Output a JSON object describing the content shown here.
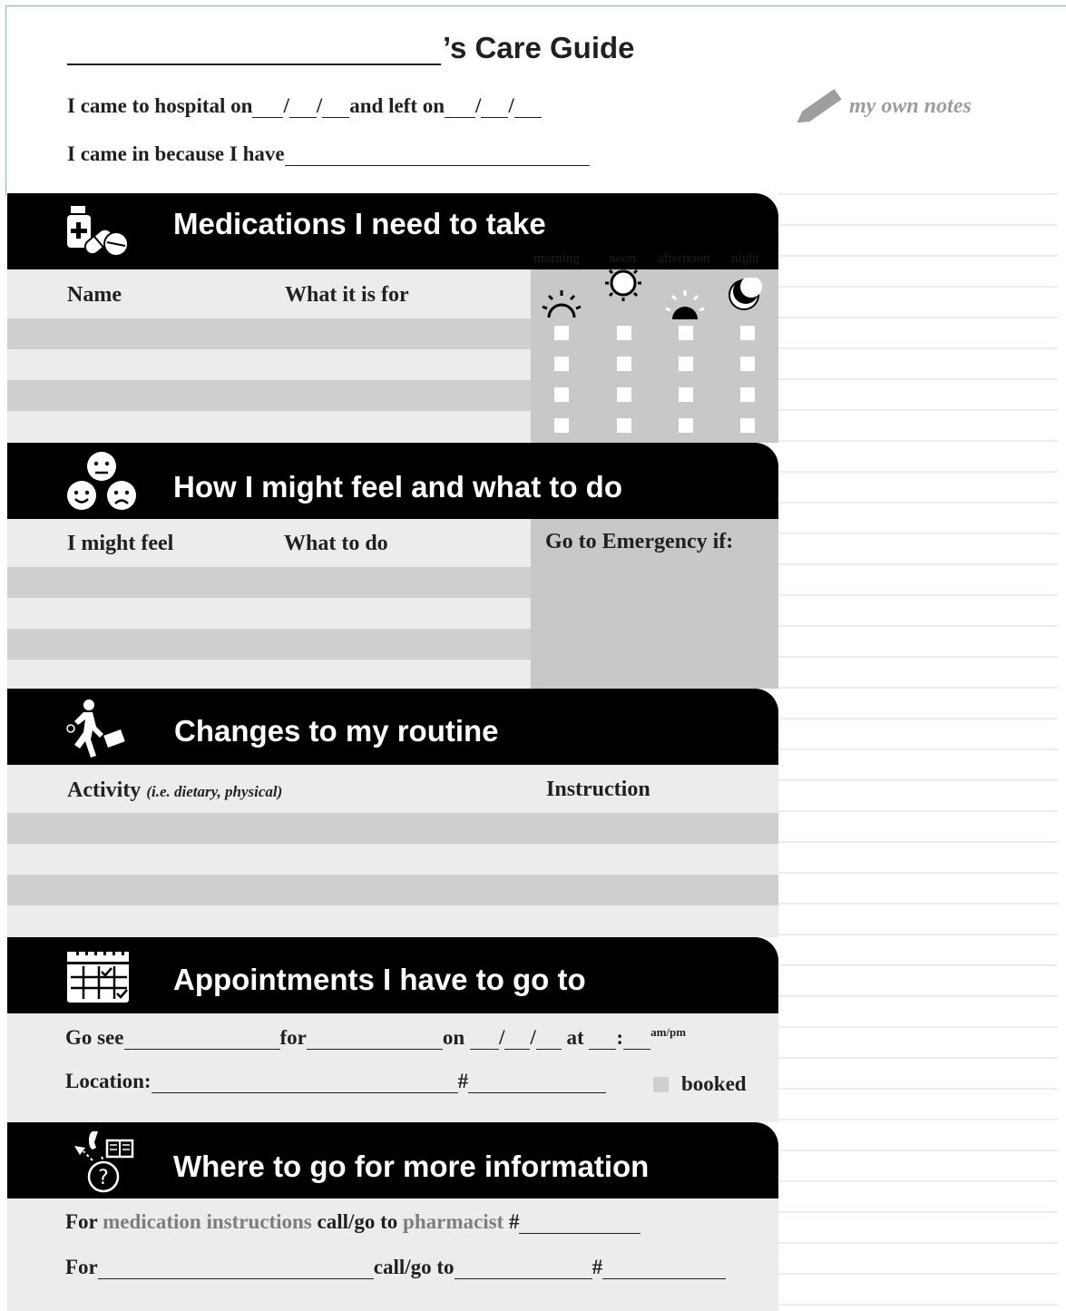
{
  "header": {
    "title_suffix": "’s Care Guide",
    "line1": {
      "came": "I came to hospital on",
      "slash": "/",
      "and_left": "and left on"
    },
    "line2": "I came in because I have",
    "notes_label": "my own notes"
  },
  "medications": {
    "title": "Medications I need to take",
    "col_name": "Name",
    "col_for": "What it is for",
    "times": [
      "morning",
      "noon",
      "afternoon",
      "night"
    ]
  },
  "feel": {
    "title": "How I might feel and what to do",
    "col_feel": "I might feel",
    "col_do": "What to do",
    "col_emergency": "Go to Emergency if:"
  },
  "routine": {
    "title": "Changes to my routine",
    "col_activity": "Activity",
    "col_activity_note": "(i.e. dietary, physical)",
    "col_instruction": "Instruction"
  },
  "appointments": {
    "title": "Appointments I have to go to",
    "go_see": "Go see",
    "for": "for",
    "on": "on",
    "slash": "/",
    "at": "at",
    "colon": ":",
    "ampm": "am/pm",
    "location": "Location:",
    "hash": "#",
    "booked": "booked"
  },
  "info": {
    "title": "Where to go for more information",
    "line1_for": "For",
    "line1_med": "medication instructions",
    "line1_call": "call/go to",
    "line1_pharm": "pharmacist",
    "hash": "#",
    "line2_for": "For",
    "line2_call": "call/go to"
  }
}
